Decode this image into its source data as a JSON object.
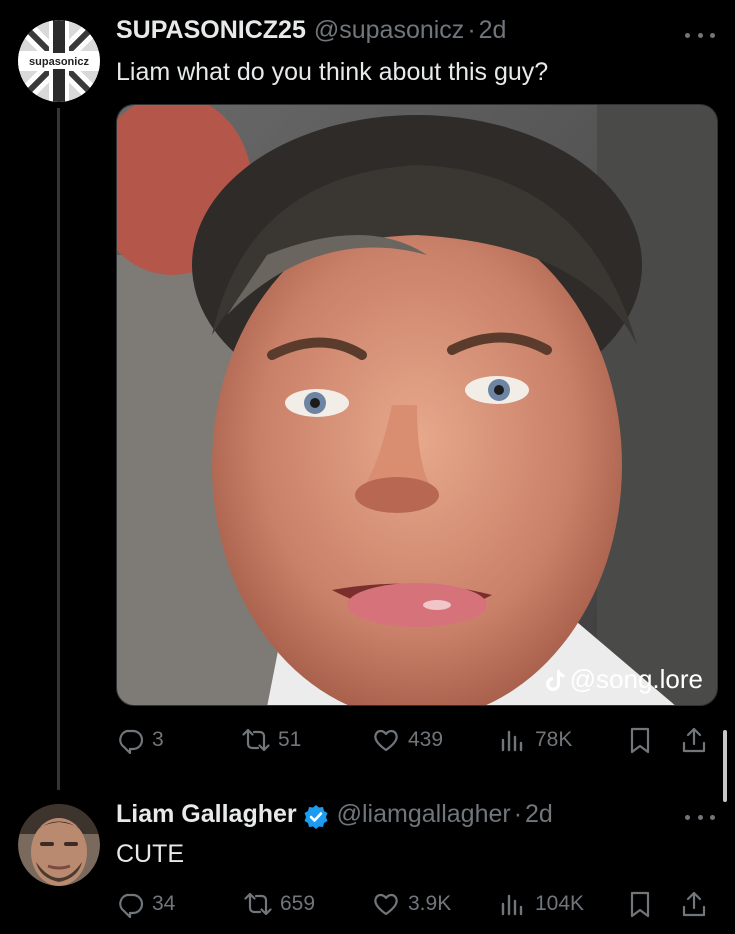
{
  "colors": {
    "background": "#000000",
    "text_primary": "#e7e9ea",
    "text_secondary": "#71767b",
    "verified": "#1d9bf0"
  },
  "tweets": [
    {
      "display_name": "SUPASONICZ25",
      "handle": "@supasonicz",
      "separator": "·",
      "time": "2d",
      "avatar_text": "supasonicz",
      "text": "Liam what do you think about this guy?",
      "media": {
        "description": "selfie",
        "watermark_icon": "tiktok-icon",
        "watermark_text": "@song.lore"
      },
      "stats": {
        "replies": "3",
        "retweets": "51",
        "likes": "439",
        "views": "78K"
      }
    },
    {
      "display_name": "Liam Gallagher",
      "verified": true,
      "handle": "@liamgallagher",
      "separator": "·",
      "time": "2d",
      "text": "CUTE",
      "stats": {
        "replies": "34",
        "retweets": "659",
        "likes": "3.9K",
        "views": "104K"
      }
    }
  ]
}
